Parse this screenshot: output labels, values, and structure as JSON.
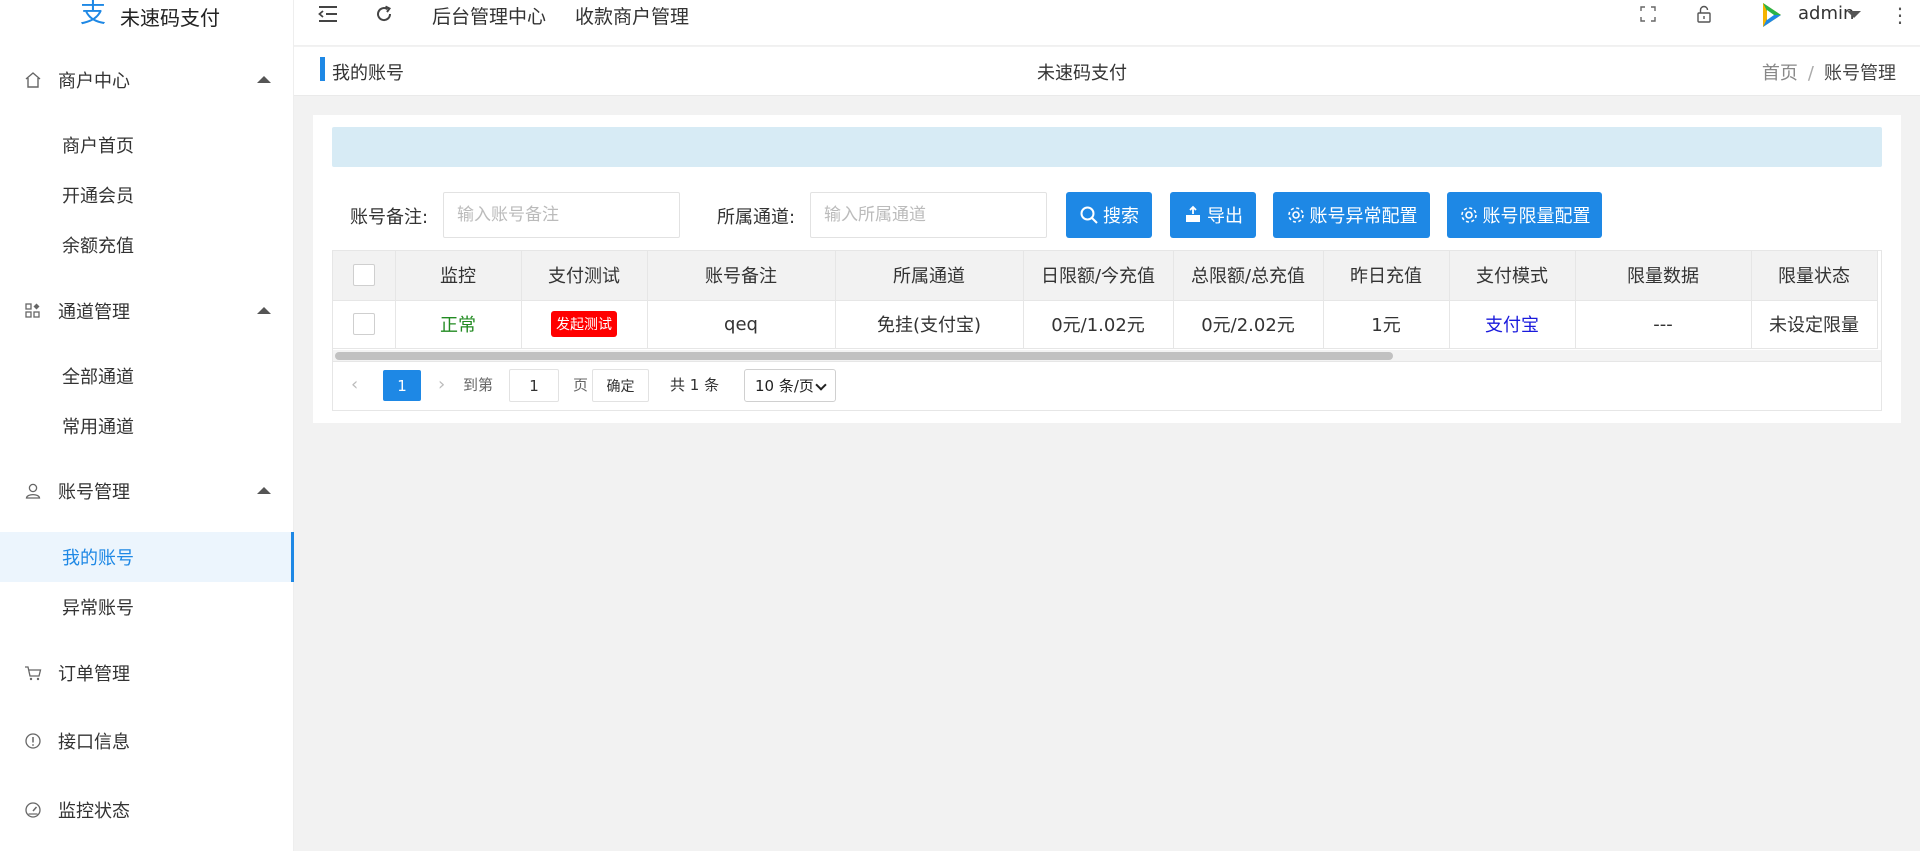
{
  "app": {
    "logo_text": "未速码支付"
  },
  "sidebar": {
    "groups": [
      {
        "label": "商户中心",
        "icon": "home-icon",
        "items": [
          "商户首页",
          "开通会员",
          "余额充值"
        ]
      },
      {
        "label": "通道管理",
        "icon": "grid-icon",
        "items": [
          "全部通道",
          "常用通道"
        ]
      },
      {
        "label": "账号管理",
        "icon": "user-icon",
        "items": [
          "我的账号",
          "异常账号"
        ]
      },
      {
        "label": "订单管理",
        "icon": "cart-icon",
        "items": []
      },
      {
        "label": "接口信息",
        "icon": "info-icon",
        "items": []
      },
      {
        "label": "监控状态",
        "icon": "gauge-icon",
        "items": []
      }
    ],
    "active_item": "我的账号"
  },
  "topbar": {
    "links": [
      "后台管理中心",
      "收款商户管理"
    ],
    "user": "admin",
    "icons": [
      "menu-fold-icon",
      "refresh-icon",
      "fullscreen-icon",
      "lock-icon",
      "more-icon"
    ]
  },
  "breadcrumb_bar": {
    "page_title": "我的账号",
    "center_title": "未速码支付",
    "crumbs": [
      "首页",
      "账号管理"
    ],
    "separator": "/"
  },
  "filters": {
    "remark_label": "账号备注:",
    "remark_placeholder": "输入账号备注",
    "channel_label": "所属通道:",
    "channel_placeholder": "输入所属通道",
    "buttons": {
      "search": "搜索",
      "export": "导出",
      "abnormal_config": "账号异常配置",
      "limit_config": "账号限量配置"
    }
  },
  "table": {
    "columns": [
      "监控",
      "支付测试",
      "账号备注",
      "所属通道",
      "日限额/今充值",
      "总限额/总充值",
      "昨日充值",
      "支付模式",
      "限量数据",
      "限量状态"
    ],
    "rows": [
      {
        "monitor": "正常",
        "pay_test": "发起测试",
        "remark": "qeq",
        "channel": "免挂(支付宝)",
        "daily": "0元/1.02元",
        "total": "0元/2.02元",
        "yesterday": "1元",
        "pay_mode": "支付宝",
        "limit_data": "---",
        "limit_status": "未设定限量"
      }
    ]
  },
  "pagination": {
    "current": "1",
    "goto_label": "到第",
    "goto_value": "1",
    "page_unit": "页",
    "confirm": "确定",
    "total": "共 1 条",
    "page_size": "10 条/页"
  },
  "colors": {
    "primary": "#1e88e5",
    "danger": "#ff0000",
    "success": "#228b22",
    "notice": "#d7ebf5"
  }
}
